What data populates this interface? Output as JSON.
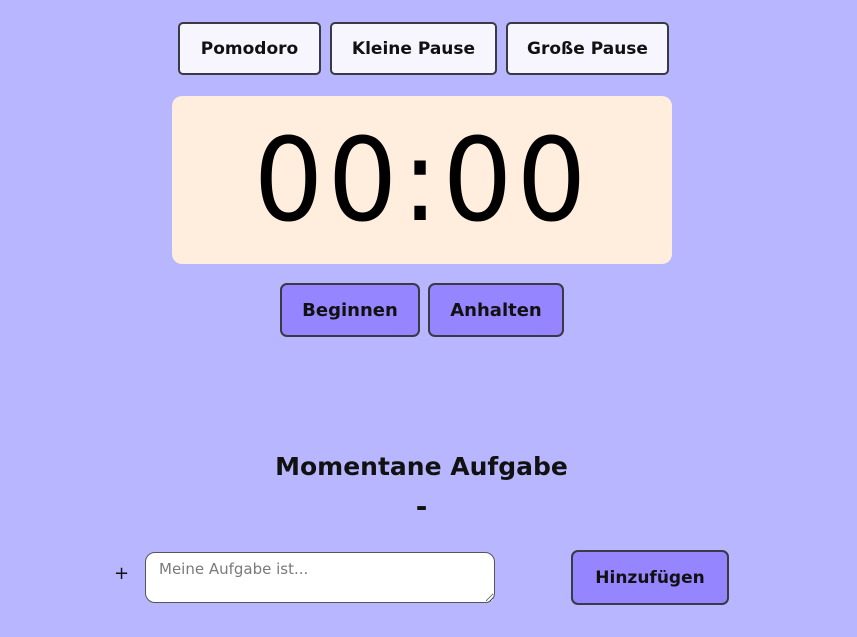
{
  "modes": {
    "pomodoro_label": "Pomodoro",
    "short_break_label": "Kleine Pause",
    "long_break_label": "Große Pause"
  },
  "timer": {
    "display": "00:00"
  },
  "controls": {
    "start_label": "Beginnen",
    "stop_label": "Anhalten"
  },
  "task": {
    "heading": "Momentane Aufgabe",
    "current": "-",
    "plus_symbol": "+",
    "input_value": "",
    "input_placeholder": "Meine Aufgabe ist...",
    "add_label": "Hinzufügen"
  },
  "colors": {
    "background": "#b7b6fe",
    "timer_background": "#ffeddd",
    "mode_button": "#f7f6ff",
    "accent_button": "#9585fe"
  }
}
